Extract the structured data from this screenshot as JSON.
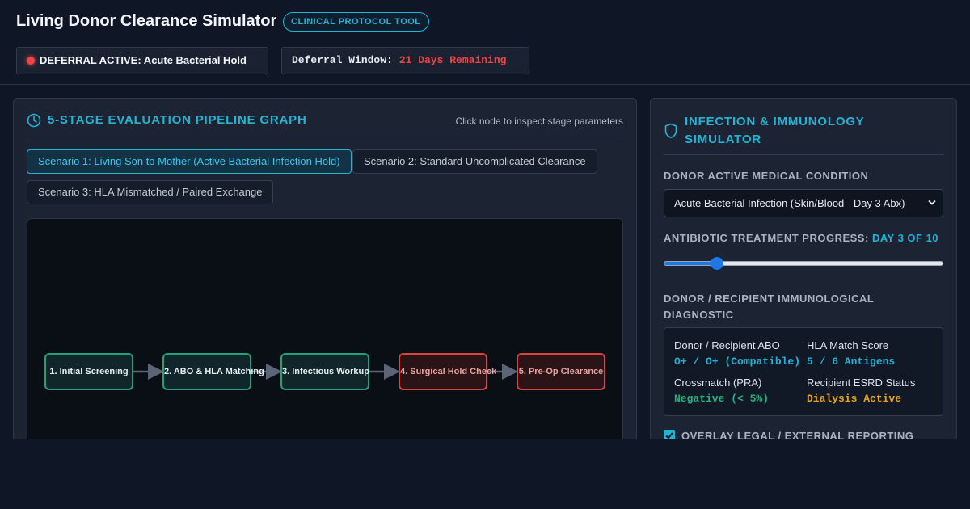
{
  "header": {
    "title": "Living Donor Clearance Simulator",
    "badge": "CLINICAL PROTOCOL TOOL",
    "deferral_status": "DEFERRAL ACTIVE: Acute Bacterial Hold",
    "window_label": "Deferral Window:",
    "window_value": "21 Days Remaining"
  },
  "pipeline": {
    "title": "5-STAGE EVALUATION PIPELINE GRAPH",
    "hint": "Click node to inspect stage parameters",
    "scenarios": [
      {
        "label": "Scenario 1: Living Son to Mother (Active Bacterial Infection Hold)",
        "active": true
      },
      {
        "label": "Scenario 2: Standard Uncomplicated Clearance",
        "active": false
      },
      {
        "label": "Scenario 3: HLA Mismatched / Paired Exchange",
        "active": false
      }
    ],
    "nodes": [
      {
        "label": "1. Initial Screening",
        "status": "cleared"
      },
      {
        "label": "2. ABO & HLA Matching",
        "status": "cleared"
      },
      {
        "label": "3. Infectious Workup",
        "status": "cleared"
      },
      {
        "label": "4. Surgical Hold Check",
        "status": "hold"
      },
      {
        "label": "5. Pre-Op Clearance",
        "status": "hold"
      }
    ]
  },
  "simulator": {
    "title": "INFECTION & IMMUNOLOGY SIMULATOR",
    "condition_label": "DONOR ACTIVE MEDICAL CONDITION",
    "condition_value": "Acute Bacterial Infection (Skin/Blood - Day 3 Abx)",
    "progress_label": "ANTIBIOTIC TREATMENT PROGRESS:",
    "progress_value": "DAY 3 OF 10",
    "progress_fraction": 0.19,
    "diagnostic_label": "DONOR / RECIPIENT IMMUNOLOGICAL DIAGNOSTIC",
    "diagnostics": [
      {
        "label": "Donor / Recipient ABO",
        "value": "O+ / O+ (Compatible)",
        "tone": "cyan"
      },
      {
        "label": "HLA Match Score",
        "value": "5 / 6 Antigens",
        "tone": "cyan"
      },
      {
        "label": "Crossmatch (PRA)",
        "value": "Negative (< 5%)",
        "tone": "green"
      },
      {
        "label": "Recipient ESRD Status",
        "value": "Dialysis Active",
        "tone": "amber"
      }
    ],
    "overlay_label": "OVERLAY LEGAL / EXTERNAL REPORTING",
    "overlay_checked": true
  },
  "colors": {
    "accent": "#22b4d4",
    "cleared": "#1fa27a",
    "hold": "#d9443c",
    "warning": "#e8a31b"
  }
}
